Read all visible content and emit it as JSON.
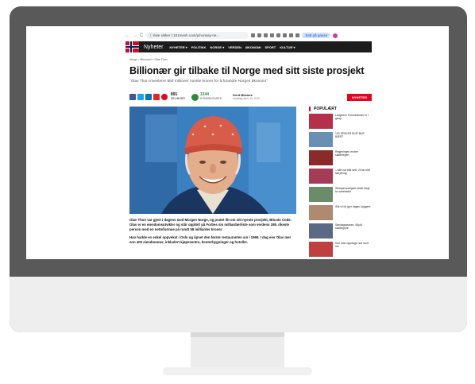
{
  "browser": {
    "back": "←",
    "forward": "→",
    "reload": "C",
    "info": "ⓘ",
    "security": "Ikke sikker",
    "separator": "|",
    "url": "101mesh.com/p/norway-ne...",
    "paused": "Sett på pause"
  },
  "site": {
    "name": "Nyheter",
    "nav": [
      "NYHETER ▾",
      "POLITIKK",
      "NORGE ▾",
      "VERDEN",
      "ØKONOMI",
      "SPORT",
      "KULTUR ▾"
    ]
  },
  "article": {
    "breadcrumb": "Norge  >  Økonomi  >  Olav Thon",
    "headline": "Billionær gir tilbake til Norge med sitt siste prosjekt",
    "lead": "\"Olav Thon investerer 850 millioner norske kroner for å forandre Norges økonomi\"",
    "shares_count": "891",
    "shares_label": "DELINGER",
    "comments_count": "1344",
    "comments_label": "KOMMENTARER",
    "author": "Kent Øksnes",
    "date": "mandag, april, 15, 2019",
    "section_tag": "NYHETER",
    "paragraphs": [
      "Olav Thon var gjest i dagens God Morgen Norge, og pratet litt om sitt nyeste prosjekt, Bitcoin Code. Olav er en eiendomsutvikler og står oppført på Forbes sin milliardærliste som verdens 198. rikeste person med en nettoformue på rundt 58 milliarder kroner.",
      "Han hadde en enkel oppvekst i Oslo og åpnet den første restauranten sin i 1966. I dag eier Olav mer enn 400 eiendommer, inkludert kjøpesentre, kontorbygninger og hoteller."
    ]
  },
  "sidebar": {
    "heading": "POPULÆRT",
    "items": [
      {
        "title": "Langrenn: Kvinnesenter er i gang"
      },
      {
        "title": "100 SEKKER BLIR BUE BÆRT"
      },
      {
        "title": "Regjeringen endrer skattelegen"
      },
      {
        "title": "– Alle har blitt sett. Vi har blitt fått jævlig"
      },
      {
        "title": "Strekpersonligvet straff: Ikkje for arbeidstid"
      },
      {
        "title": "Slik vil du gjer dagen hyggere"
      },
      {
        "title": "Søndagsavisen: Skjult skattegryte"
      },
      {
        "title": "Kan man oppdage noe stort her"
      }
    ]
  },
  "colors": {
    "accent": "#e0081c",
    "monitor": "#595959",
    "navbar": "#1c1c1c",
    "photo_bg": "#3a7fc0",
    "comment": "#2e8b3a",
    "facebook": "#3b5998",
    "twitter": "#1da1f2",
    "linkedin": "#0077b5",
    "flipboard": "#e12828",
    "email": "#e0081c"
  },
  "share_icons": [
    "facebook-icon",
    "twitter-icon",
    "linkedin-icon",
    "flipboard-icon",
    "email-icon"
  ]
}
